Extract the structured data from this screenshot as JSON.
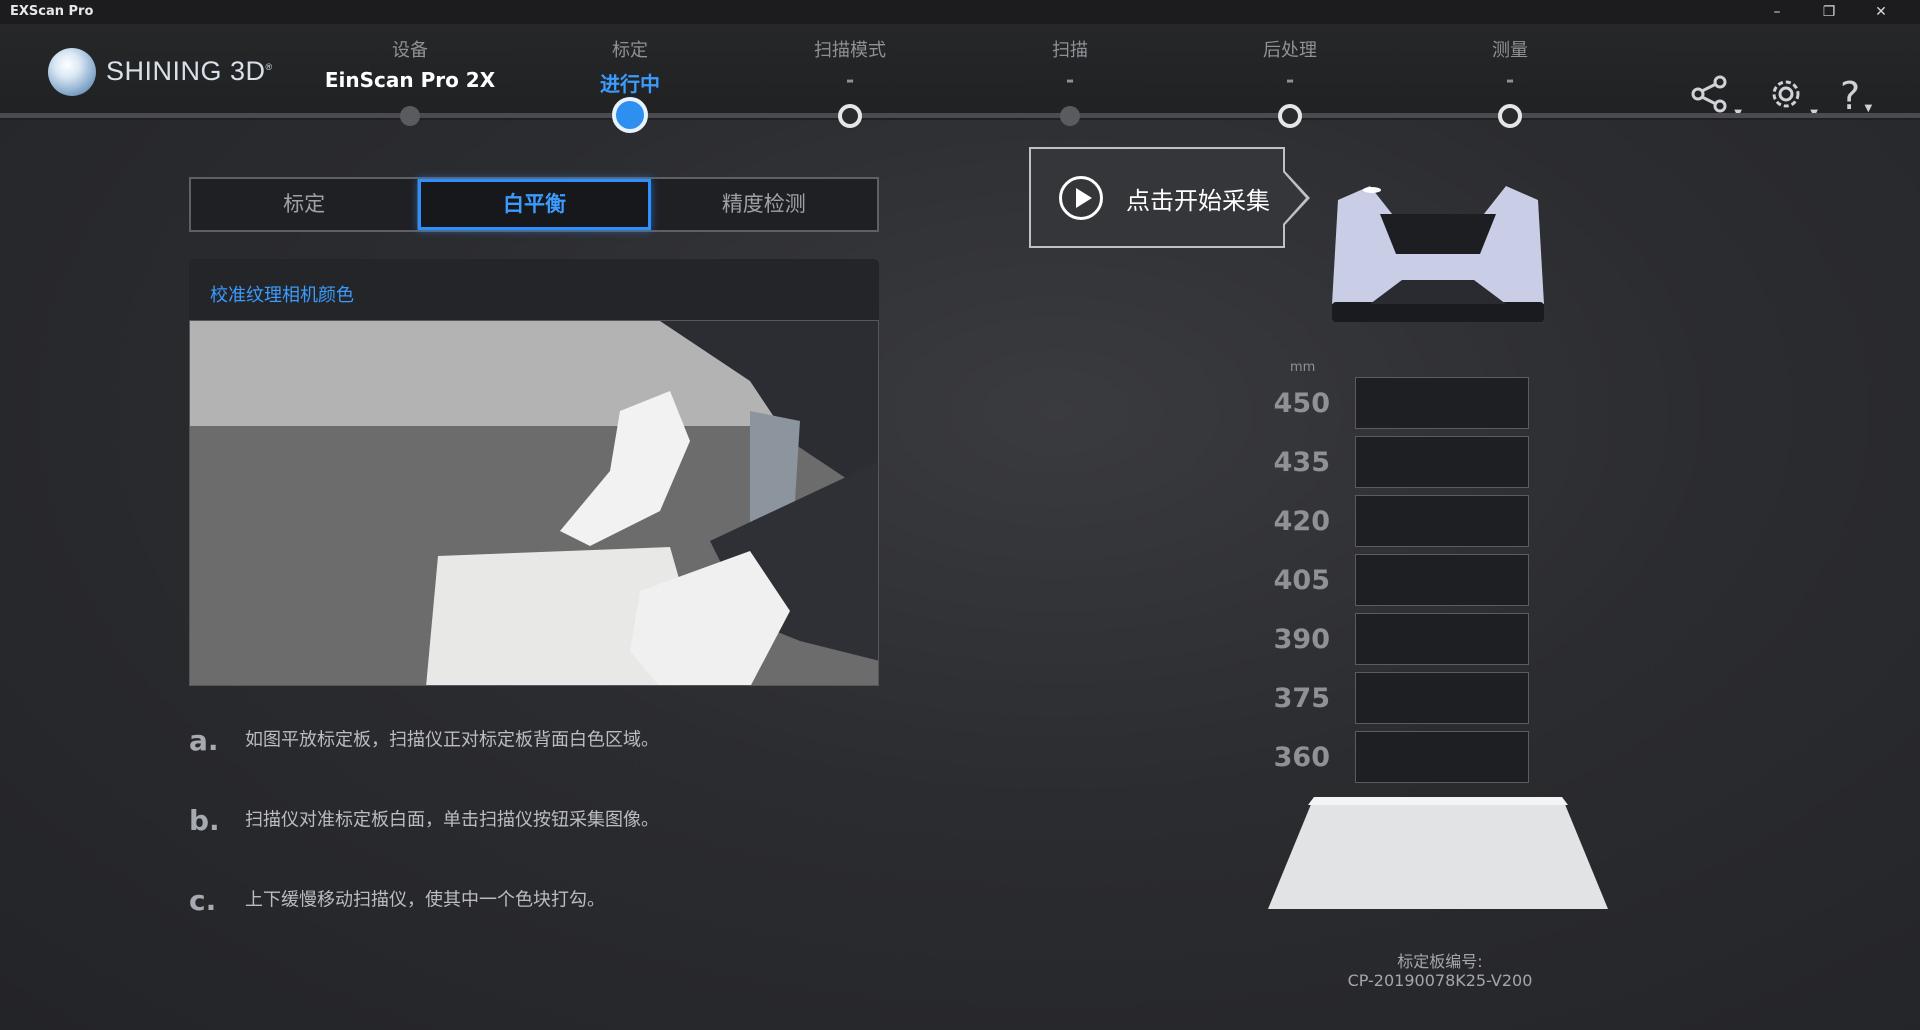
{
  "window": {
    "title": "EXScan Pro"
  },
  "header": {
    "brand": "SHINING 3D",
    "steps": [
      {
        "label": "设备",
        "value": "EinScan Pro 2X",
        "state": "done"
      },
      {
        "label": "标定",
        "value": "进行中",
        "state": "current"
      },
      {
        "label": "扫描模式",
        "value": "-",
        "state": "pending"
      },
      {
        "label": "扫描",
        "value": "-",
        "state": "disabled"
      },
      {
        "label": "后处理",
        "value": "-",
        "state": "pending"
      },
      {
        "label": "测量",
        "value": "-",
        "state": "pending"
      }
    ],
    "icons": [
      "share-icon",
      "settings-icon",
      "help-icon"
    ]
  },
  "tabs": [
    {
      "label": "标定",
      "active": false
    },
    {
      "label": "白平衡",
      "active": true
    },
    {
      "label": "精度检测",
      "active": false
    }
  ],
  "panel": {
    "title": "校准纹理相机颜色"
  },
  "instructions": [
    {
      "mark": "a.",
      "text": "如图平放标定板，扫描仪正对标定板背面白色区域。"
    },
    {
      "mark": "b.",
      "text": "扫描仪对准标定板白面，单击扫描仪按钮采集图像。"
    },
    {
      "mark": "c.",
      "text": "上下缓慢移动扫描仪，使其中一个色块打勾。"
    }
  ],
  "start_button": {
    "label": "点击开始采集"
  },
  "distance": {
    "unit": "mm",
    "levels": [
      "450",
      "435",
      "420",
      "405",
      "390",
      "375",
      "360"
    ]
  },
  "calibration_board": {
    "label": "标定板编号:",
    "id": "CP-20190078K25-V200"
  },
  "colors": {
    "accent": "#2f8fff",
    "background": "#2b2c30"
  }
}
